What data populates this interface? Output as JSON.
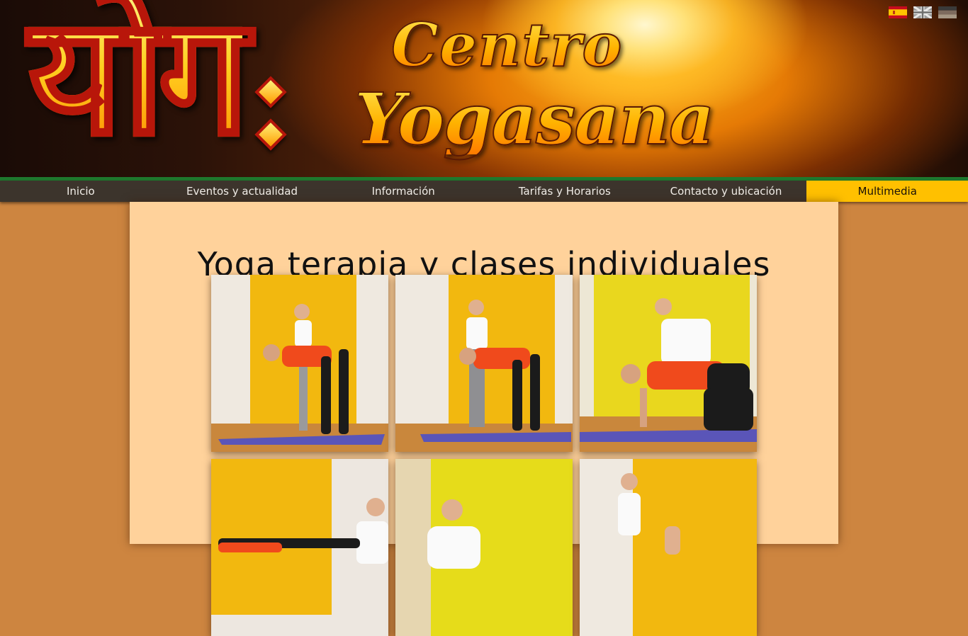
{
  "header": {
    "logo_glyph": "योग",
    "title_line1": "Centro",
    "title_line2": "Yogasana"
  },
  "languages": [
    {
      "code": "es",
      "icon": "spain-flag-icon"
    },
    {
      "code": "en",
      "icon": "uk-flag-icon"
    },
    {
      "code": "de",
      "icon": "germany-flag-icon"
    }
  ],
  "nav": {
    "items": [
      {
        "label": "Inicio",
        "active": false
      },
      {
        "label": "Eventos y actualidad",
        "active": false
      },
      {
        "label": "Información",
        "active": false
      },
      {
        "label": "Tarifas y Horarios",
        "active": false
      },
      {
        "label": "Contacto y ubicación",
        "active": false
      },
      {
        "label": "Multimedia",
        "active": true
      }
    ],
    "active_color": "#ffc000"
  },
  "main": {
    "title": "Yoga terapia y clases individuales",
    "gallery_count_visible": 6
  },
  "colors": {
    "page_background": "#cd8540",
    "content_background": "#ffd29b",
    "nav_background": "#3c342c",
    "nav_top_line": "#1f7a2e"
  }
}
